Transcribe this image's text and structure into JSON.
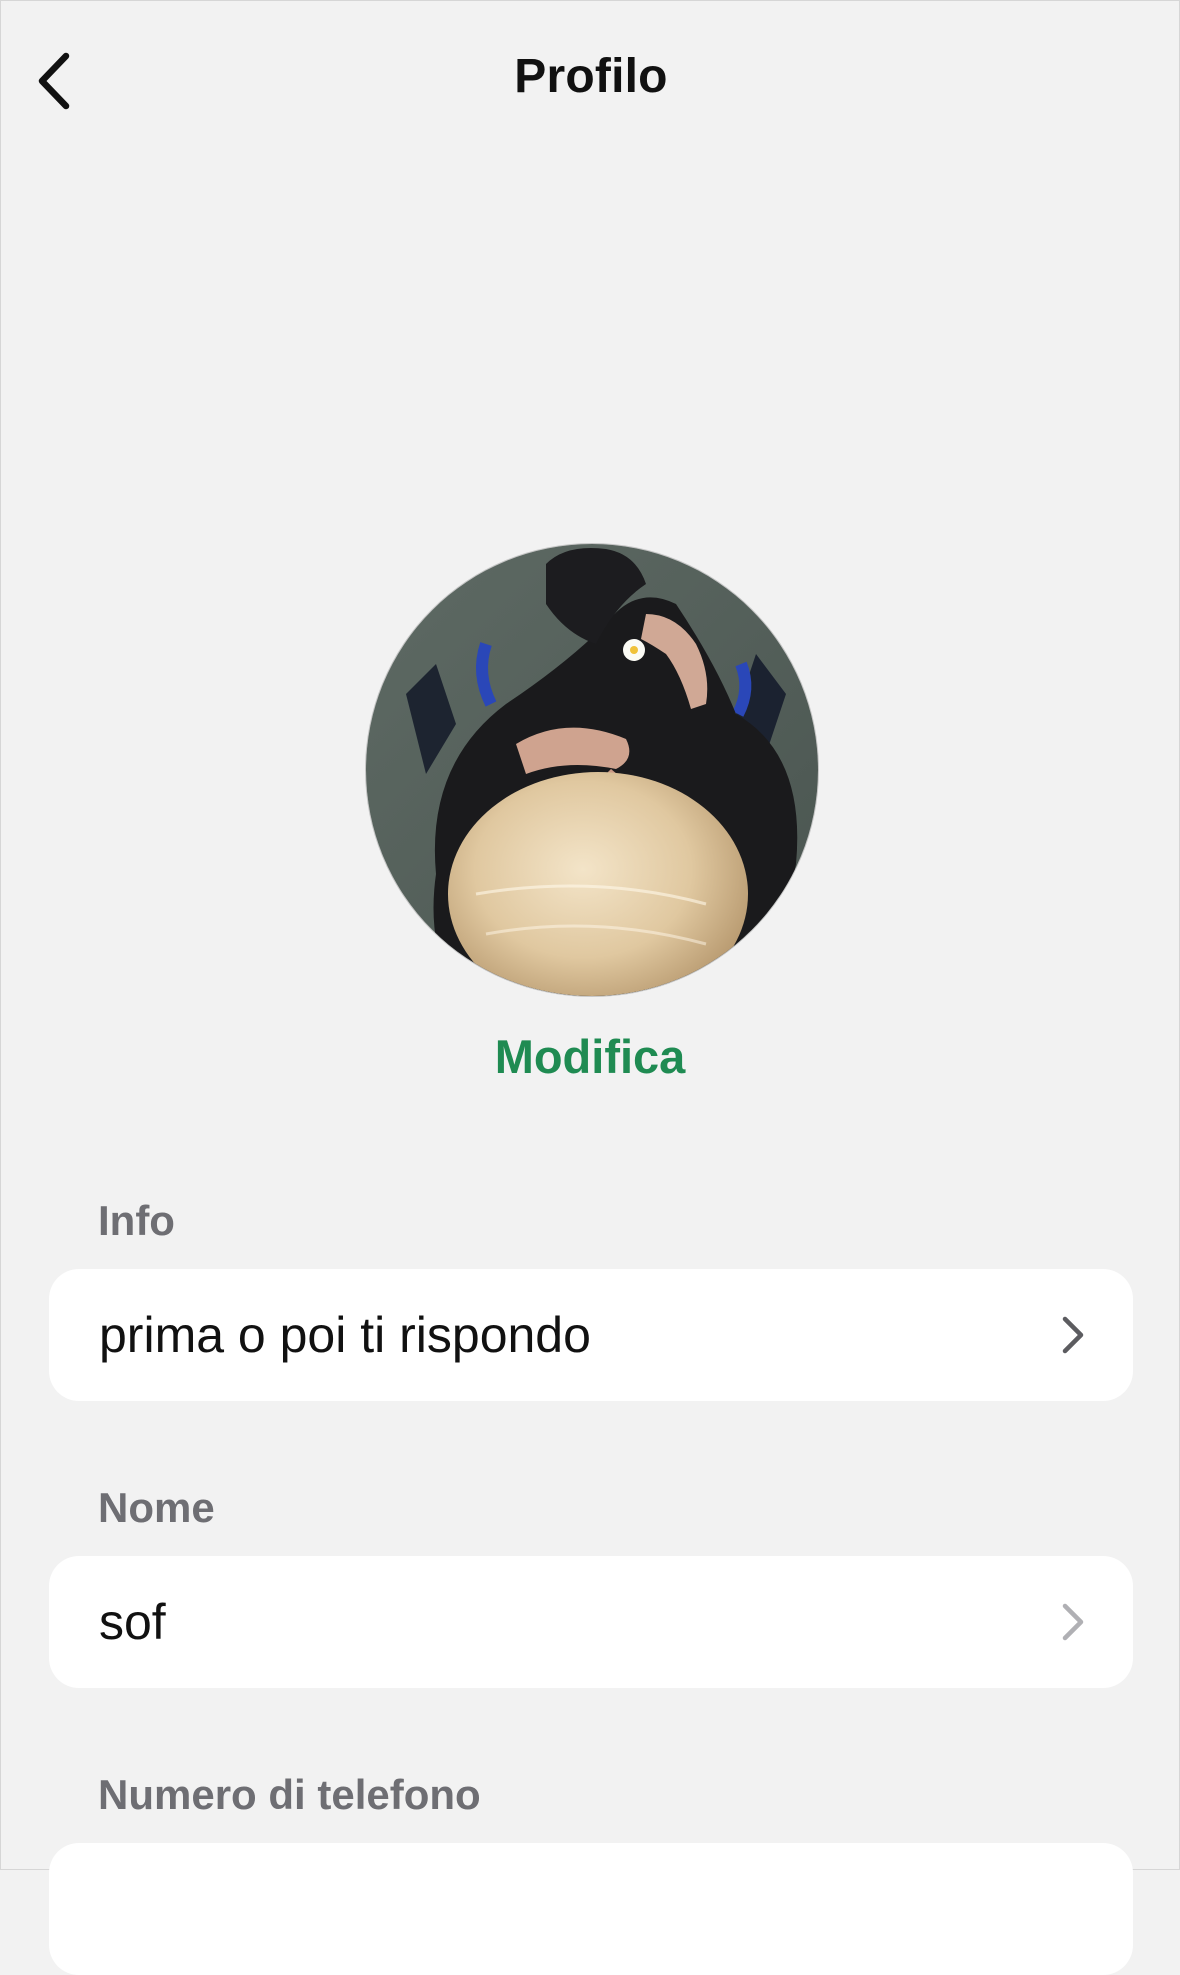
{
  "header": {
    "title": "Profilo",
    "back_icon": "chevron-left-icon"
  },
  "profile": {
    "edit_label": "Modifica",
    "accent_color": "#1f8b52"
  },
  "sections": {
    "info": {
      "label": "Info",
      "value": "prima o poi ti rispondo"
    },
    "name": {
      "label": "Nome",
      "value": "sof"
    },
    "phone": {
      "label": "Numero di telefono"
    }
  }
}
